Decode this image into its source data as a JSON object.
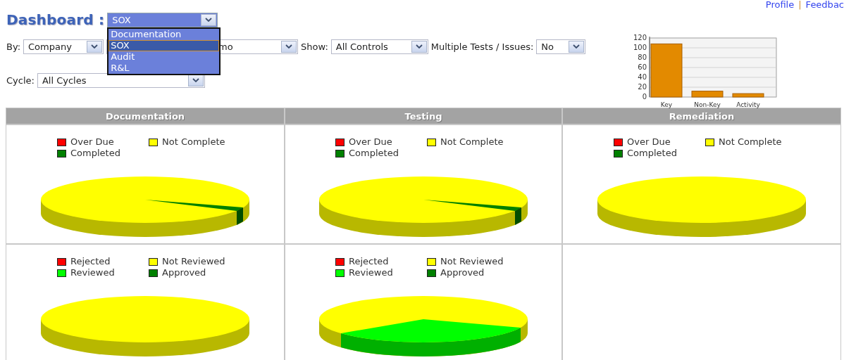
{
  "header": {
    "title": "Dashboard :",
    "links": [
      "Profile",
      "Feedbac"
    ],
    "separator": "|"
  },
  "dashboard_select": {
    "value": "SOX",
    "expanded": true,
    "options": [
      {
        "label": "Documentation",
        "selected": false
      },
      {
        "label": "SOX",
        "selected": true
      },
      {
        "label": "Audit",
        "selected": false
      },
      {
        "label": "R&L",
        "selected": false
      }
    ]
  },
  "filters": [
    {
      "label": "By:",
      "value": "Company"
    },
    {
      "value": "mo"
    },
    {
      "label": "Show:",
      "value": "All Controls"
    },
    {
      "label": "Multiple Tests / Issues:",
      "value": "No"
    }
  ],
  "cycle": {
    "label": "Cycle:",
    "value": "All Cycles"
  },
  "summary_chart": {
    "chart_data": {
      "type": "bar",
      "categories": [
        "Key",
        "Non-Key",
        "Activity"
      ],
      "values": [
        108,
        12,
        7
      ],
      "ylim": [
        0,
        120
      ],
      "yticks": [
        0,
        20,
        40,
        60,
        80,
        100,
        120
      ],
      "grid": true
    }
  },
  "columns": [
    "Documentation",
    "Testing",
    "Remediation"
  ],
  "panels": [
    {
      "kind": "sliver",
      "legend": [
        {
          "label": "Over Due",
          "color": "#ff0000"
        },
        {
          "label": "Not Complete",
          "color": "#ffff00"
        },
        {
          "label": "Completed",
          "color": "#008000"
        }
      ]
    },
    {
      "kind": "sliver",
      "legend": [
        {
          "label": "Over Due",
          "color": "#ff0000"
        },
        {
          "label": "Not Complete",
          "color": "#ffff00"
        },
        {
          "label": "Completed",
          "color": "#008000"
        }
      ]
    },
    {
      "kind": "plain",
      "legend": [
        {
          "label": "Over Due",
          "color": "#ff0000"
        },
        {
          "label": "Not Complete",
          "color": "#ffff00"
        },
        {
          "label": "Completed",
          "color": "#008000"
        }
      ]
    },
    {
      "kind": "plain",
      "legend": [
        {
          "label": "Rejected",
          "color": "#ff0000"
        },
        {
          "label": "Not Reviewed",
          "color": "#ffff00"
        },
        {
          "label": "Reviewed",
          "color": "#00ff00"
        },
        {
          "label": "Approved",
          "color": "#008000"
        }
      ]
    },
    {
      "kind": "wedge",
      "legend": [
        {
          "label": "Rejected",
          "color": "#ff0000"
        },
        {
          "label": "Not Reviewed",
          "color": "#ffff00"
        },
        {
          "label": "Reviewed",
          "color": "#00ff00"
        },
        {
          "label": "Approved",
          "color": "#008000"
        }
      ]
    },
    {
      "kind": "empty"
    }
  ]
}
